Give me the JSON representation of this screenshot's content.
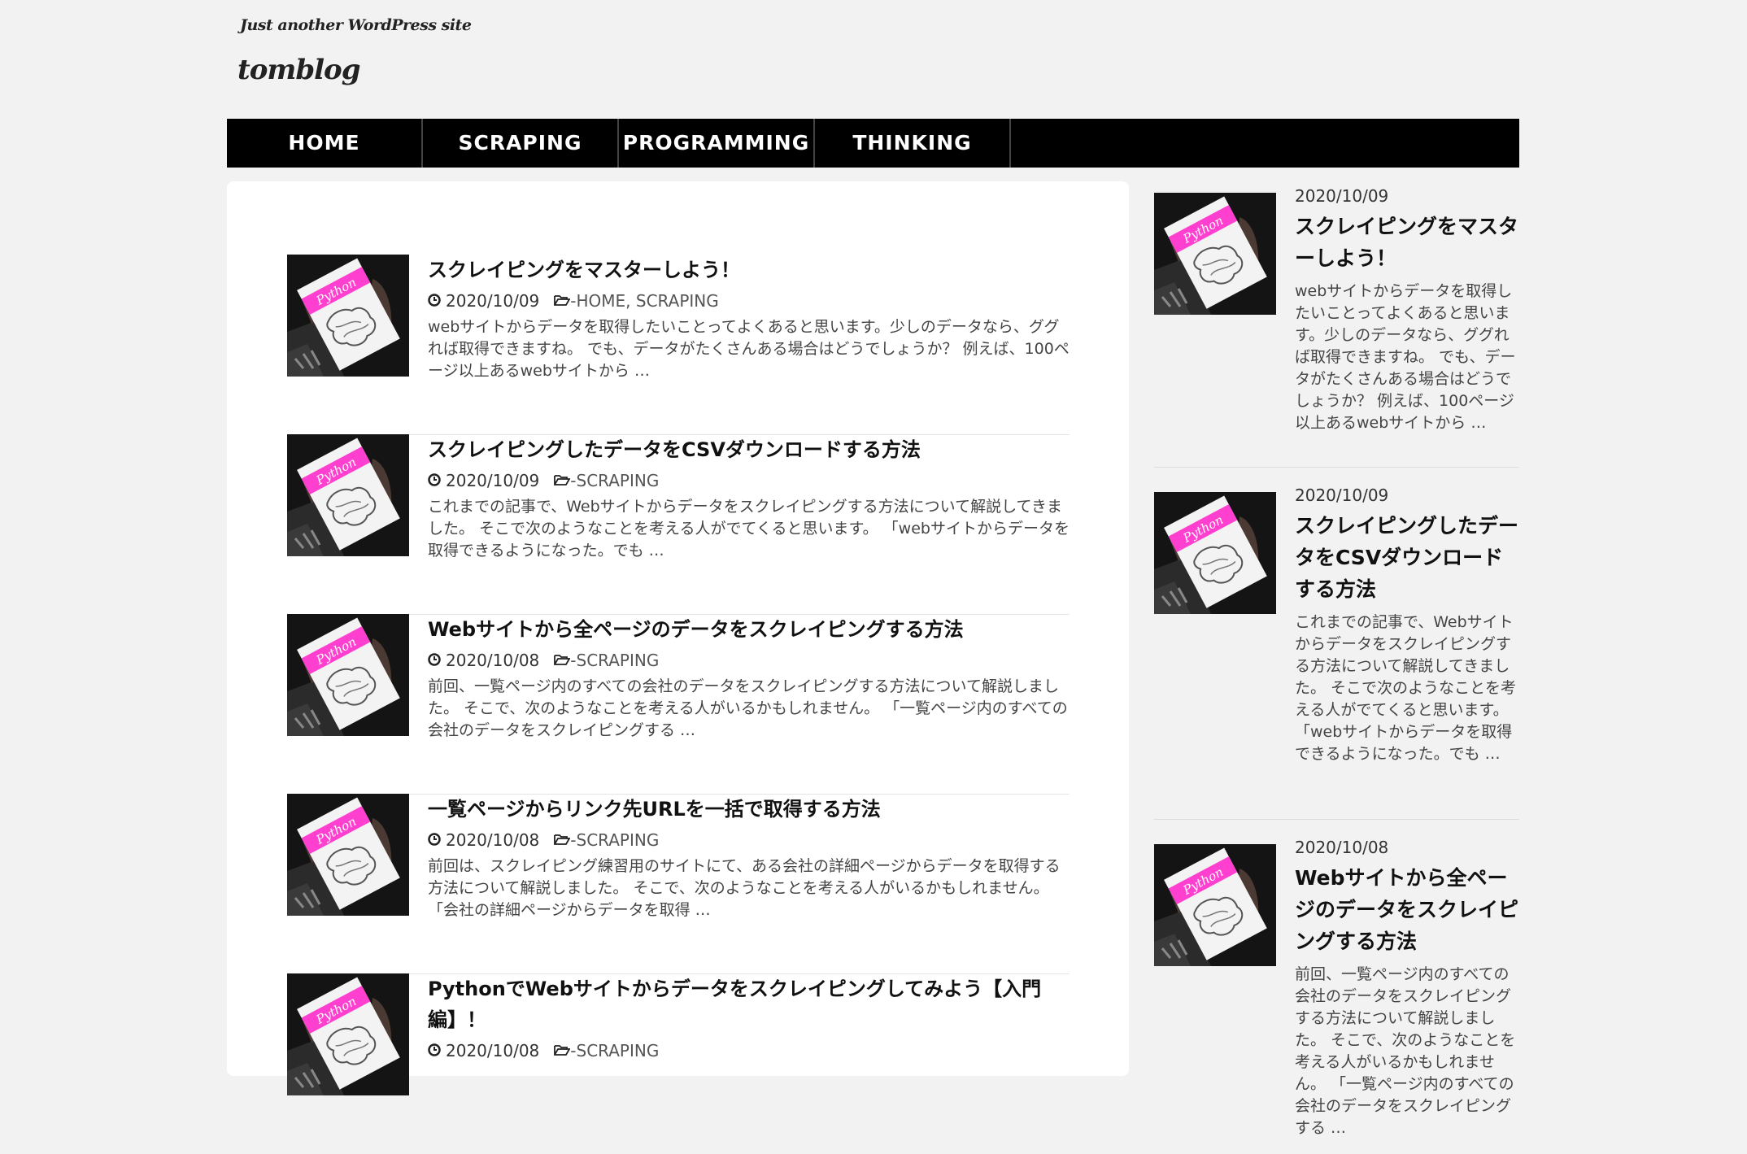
{
  "site": {
    "tagline": "Just another WordPress site",
    "title": "tomblog"
  },
  "nav": {
    "items": [
      "HOME",
      "SCRAPING",
      "PROGRAMMING",
      "THINKING"
    ]
  },
  "thumbnail": {
    "book_label": "Python",
    "book_color": "#ff3fcf"
  },
  "posts": [
    {
      "title": "スクレイピングをマスターしよう！",
      "date": "2020/10/09",
      "categories": "-HOME, SCRAPING",
      "excerpt": "webサイトからデータを取得したいことってよくあると思います。少しのデータなら、ググれば取得できますね。 でも、データがたくさんある場合はどうでしょうか？ 例えば、100ページ以上あるwebサイトから …"
    },
    {
      "title": "スクレイピングしたデータをCSVダウンロードする方法",
      "date": "2020/10/09",
      "categories": "-SCRAPING",
      "excerpt": "これまでの記事で、Webサイトからデータをスクレイピングする方法について解説してきました。 そこで次のようなことを考える人がでてくると思います。 「webサイトからデータを取得できるようになった。でも …"
    },
    {
      "title": "Webサイトから全ページのデータをスクレイピングする方法",
      "date": "2020/10/08",
      "categories": "-SCRAPING",
      "excerpt": "前回、一覧ページ内のすべての会社のデータをスクレイピングする方法について解説しました。 そこで、次のようなことを考える人がいるかもしれません。 「一覧ページ内のすべての会社のデータをスクレイピングする …"
    },
    {
      "title": "一覧ページからリンク先URLを一括で取得する方法",
      "date": "2020/10/08",
      "categories": "-SCRAPING",
      "excerpt": "前回は、スクレイピング練習用のサイトにて、ある会社の詳細ページからデータを取得する方法について解説しました。 そこで、次のようなことを考える人がいるかもしれません。 「会社の詳細ページからデータを取得 …"
    },
    {
      "title": "PythonでWebサイトからデータをスクレイピングしてみよう【入門編】！",
      "date": "2020/10/08",
      "categories": "-SCRAPING",
      "excerpt": ""
    }
  ],
  "sidebar": {
    "posts": [
      {
        "date": "2020/10/09",
        "title": "スクレイピングをマスターしよう！",
        "excerpt": "webサイトからデータを取得したいことってよくあると思います。少しのデータなら、ググれば取得できますね。 でも、データがたくさんある場合はどうでしょうか？ 例えば、100ページ以上あるwebサイトから …"
      },
      {
        "date": "2020/10/09",
        "title": "スクレイピングしたデータをCSVダウンロードする方法",
        "excerpt": "これまでの記事で、Webサイトからデータをスクレイピングする方法について解説してきました。 そこで次のようなことを考える人がでてくると思います。 「webサイトからデータを取得できるようになった。でも …"
      },
      {
        "date": "2020/10/08",
        "title": "Webサイトから全ページのデータをスクレイピングする方法",
        "excerpt": "前回、一覧ページ内のすべての会社のデータをスクレイピングする方法について解説しました。 そこで、次のようなことを考える人がいるかもしれません。 「一覧ページ内のすべての会社のデータをスクレイピングする …"
      }
    ]
  }
}
